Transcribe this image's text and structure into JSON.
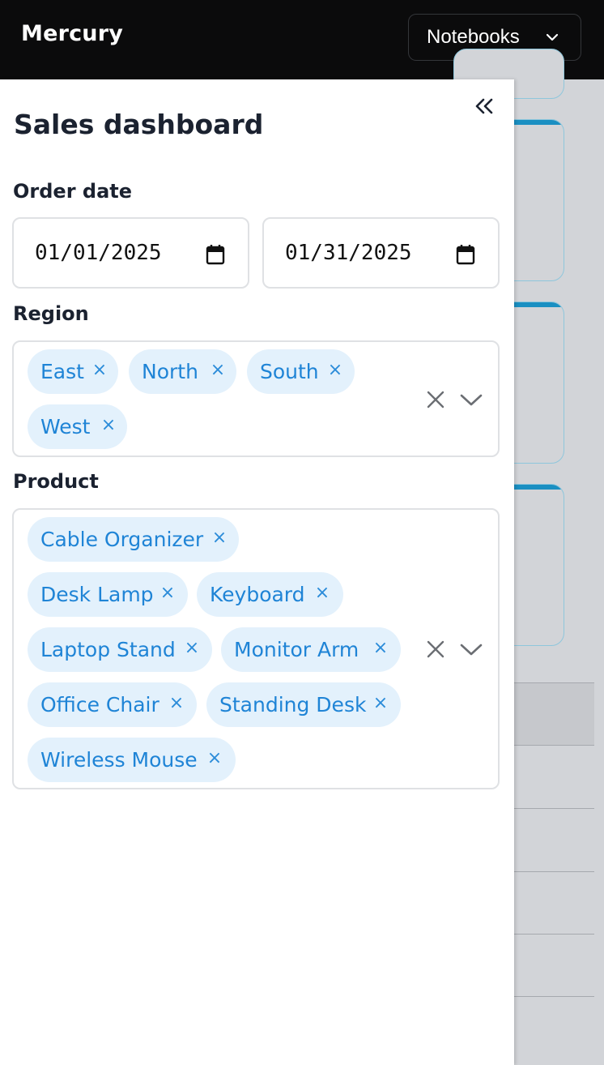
{
  "app": {
    "brand": "Mercury",
    "nav_dropdown": "Notebooks"
  },
  "sidebar": {
    "title": "Sales dashboard",
    "order_date": {
      "label": "Order date",
      "start": "01/01/2025",
      "end": "01/31/2025"
    },
    "region": {
      "label": "Region",
      "selected": [
        "East",
        "North",
        "South",
        "West"
      ]
    },
    "product": {
      "label": "Product",
      "selected": [
        "Cable Organizer",
        "Desk Lamp",
        "Keyboard",
        "Laptop Stand",
        "Monitor Arm",
        "Office Chair",
        "Standing Desk",
        "Wireless Mouse"
      ]
    }
  },
  "colors": {
    "topbar": "#0b0b0c",
    "chip_bg": "#e3f1fc",
    "chip_text": "#1f84d6",
    "card_accent": "#1a8fc2"
  },
  "icons": {
    "collapse": "double-chevron-left-icon",
    "calendar": "calendar-icon",
    "clear": "close-icon",
    "dropdown": "chevron-down-icon",
    "chip_remove": "remove-x-icon"
  }
}
